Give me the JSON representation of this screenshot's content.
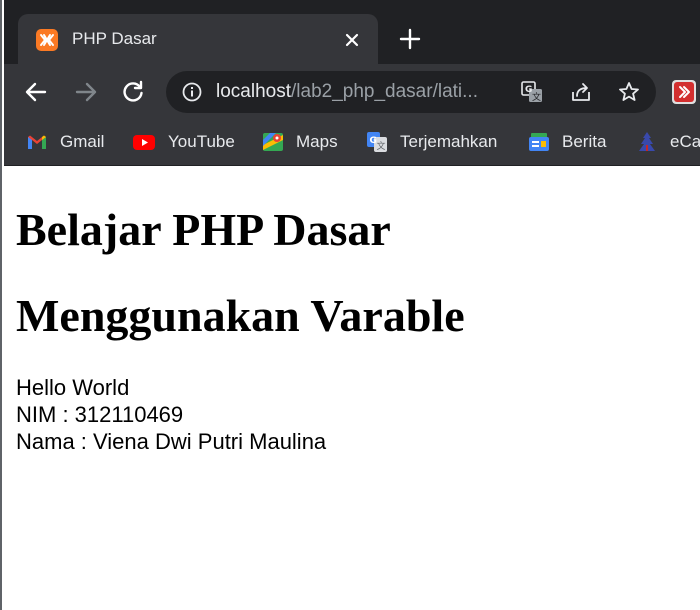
{
  "browser": {
    "tab": {
      "title": "PHP Dasar",
      "favicon": "xampp-icon"
    },
    "new_tab": "plus-icon",
    "address": {
      "host": "localhost",
      "path": "/lab2_php_dasar/lati..."
    },
    "colors": {
      "tabstrip": "#202124",
      "toolbar": "#35363a",
      "omnibox": "#202124",
      "text": "#e8eaed",
      "muted": "#9aa0a6"
    }
  },
  "bookmarks": [
    {
      "label": "Gmail",
      "icon": "gmail-icon"
    },
    {
      "label": "YouTube",
      "icon": "youtube-icon"
    },
    {
      "label": "Maps",
      "icon": "maps-icon"
    },
    {
      "label": "Terjemahkan",
      "icon": "translate-icon"
    },
    {
      "label": "Berita",
      "icon": "news-icon"
    },
    {
      "label": "eCar",
      "icon": "ecampus-icon"
    }
  ],
  "page": {
    "heading1": "Belajar PHP Dasar",
    "heading2": "Menggunakan Varable",
    "lines": [
      "Hello World",
      "NIM : 312110469",
      "Nama : Viena Dwi Putri Maulina"
    ]
  }
}
